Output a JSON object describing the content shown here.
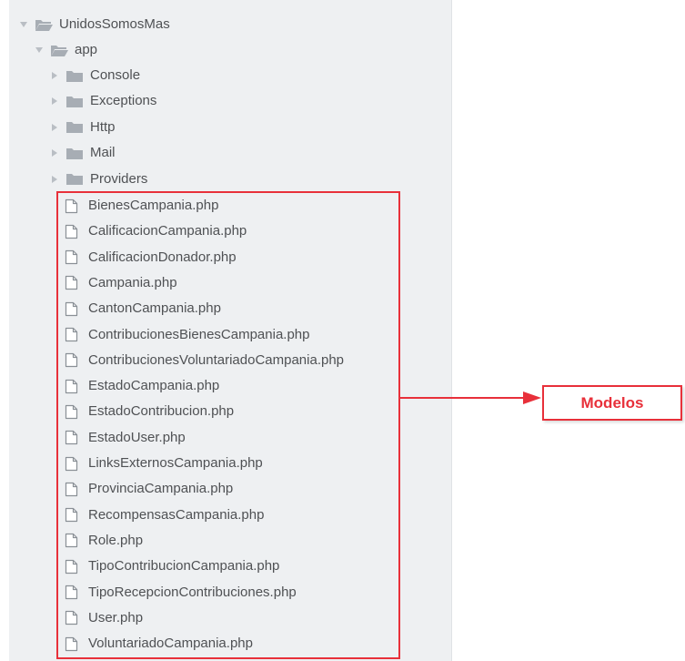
{
  "tree": {
    "root": {
      "label": "UnidosSomosMas",
      "icon": "folder-open-icon",
      "expanded": true
    },
    "app": {
      "label": "app",
      "icon": "folder-open-icon",
      "expanded": true
    },
    "folders": [
      {
        "label": "Console",
        "icon": "folder-icon"
      },
      {
        "label": "Exceptions",
        "icon": "folder-icon"
      },
      {
        "label": "Http",
        "icon": "folder-icon"
      },
      {
        "label": "Mail",
        "icon": "folder-icon"
      },
      {
        "label": "Providers",
        "icon": "folder-icon"
      }
    ],
    "files": [
      {
        "label": "BienesCampania.php"
      },
      {
        "label": "CalificacionCampania.php"
      },
      {
        "label": "CalificacionDonador.php"
      },
      {
        "label": "Campania.php"
      },
      {
        "label": "CantonCampania.php"
      },
      {
        "label": "ContribucionesBienesCampania.php"
      },
      {
        "label": "ContribucionesVoluntariadoCampania.php"
      },
      {
        "label": "EstadoCampania.php"
      },
      {
        "label": "EstadoContribucion.php"
      },
      {
        "label": "EstadoUser.php"
      },
      {
        "label": "LinksExternosCampania.php"
      },
      {
        "label": "ProvinciaCampania.php"
      },
      {
        "label": "RecompensasCampania.php"
      },
      {
        "label": "Role.php"
      },
      {
        "label": "TipoContribucionCampania.php"
      },
      {
        "label": "TipoRecepcionContribuciones.php"
      },
      {
        "label": "User.php"
      },
      {
        "label": "VoluntariadoCampania.php"
      }
    ]
  },
  "annotation": {
    "label": "Modelos",
    "color": "#e8303a"
  },
  "colors": {
    "panel_bg": "#eef0f2",
    "text": "#4f5154",
    "folder": "#a7adb4",
    "arrow": "#b9bec4"
  }
}
